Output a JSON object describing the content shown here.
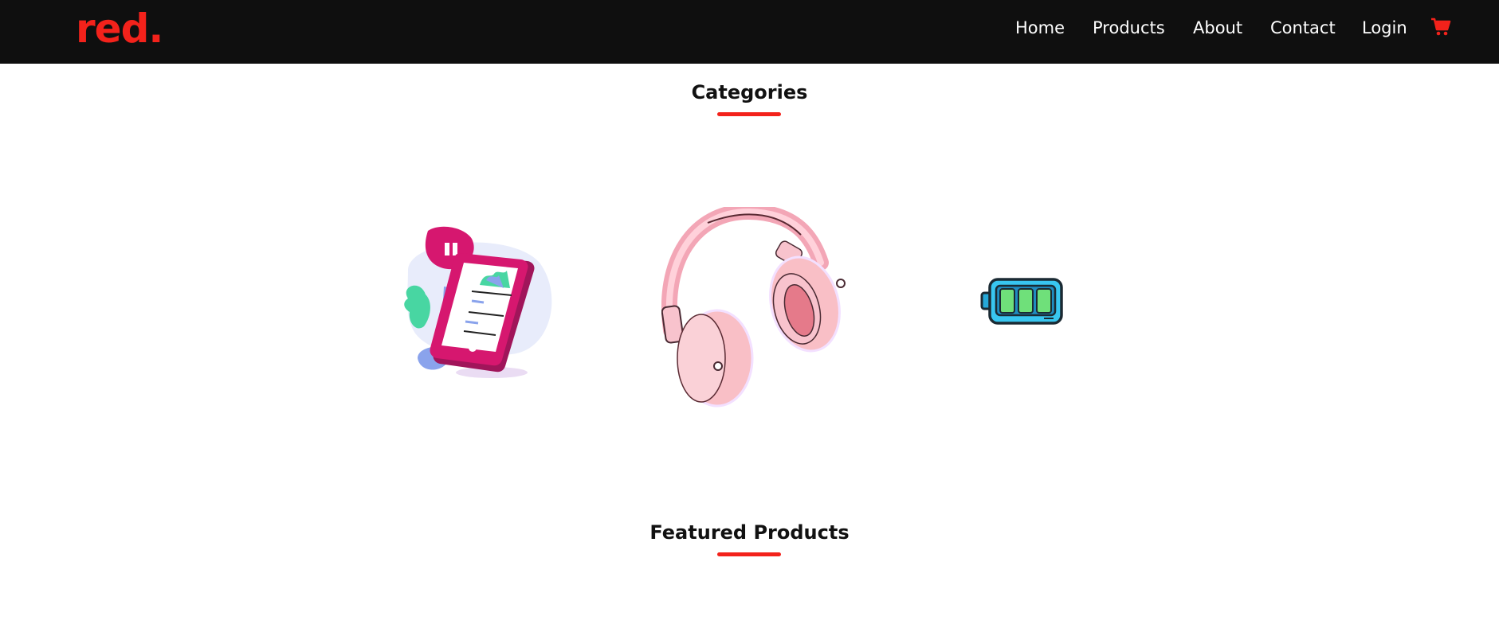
{
  "brand": {
    "logo_text": "red.",
    "accent_color": "#f3221b",
    "navbar_bg": "#0f0f0f"
  },
  "nav": {
    "items": [
      {
        "label": "Home"
      },
      {
        "label": "Products"
      },
      {
        "label": "About"
      },
      {
        "label": "Contact"
      },
      {
        "label": "Login"
      }
    ],
    "cart_icon": "shopping-cart-icon"
  },
  "categories": {
    "title": "Categories",
    "items": [
      {
        "icon": "smartphone-illustration"
      },
      {
        "icon": "headphones-illustration"
      },
      {
        "icon": "battery-illustration"
      }
    ]
  },
  "featured": {
    "title": "Featured Products"
  }
}
